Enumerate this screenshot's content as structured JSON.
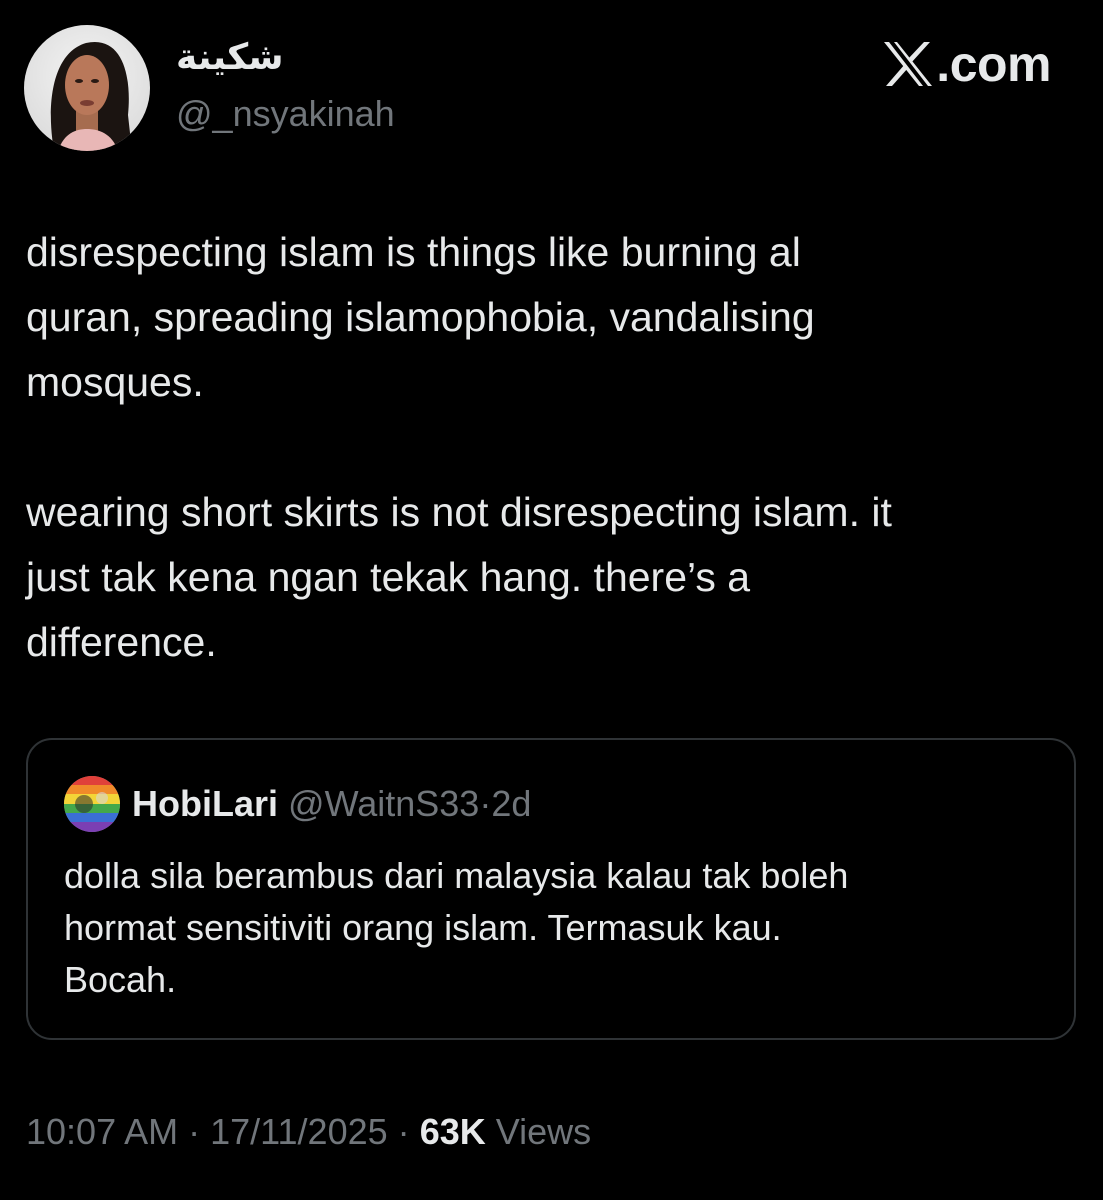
{
  "author": {
    "display_name": "شكينة",
    "handle": "@_nsyakinah"
  },
  "brand": {
    "icon": "x-logo-icon",
    "suffix": ".com"
  },
  "tweet": {
    "paragraphs": [
      "disrespecting islam is things like burning al\nquran, spreading islamophobia, vandalising\nmosques.",
      "wearing short skirts is not disrespecting islam. it\njust tak kena ngan tekak hang. there’s a\ndifference."
    ]
  },
  "quote": {
    "display_name": "HobiLari",
    "handle": "@WaitnS33",
    "separator": "·",
    "time": "2d",
    "text": "dolla sila berambus dari malaysia kalau tak boleh\nhormat sensitiviti orang islam. Termasuk kau.\nBocah."
  },
  "meta": {
    "time": "10:07 AM",
    "separator": "·",
    "date": "17/11/2025",
    "views_count": "63K",
    "views_label": "Views"
  },
  "colors": {
    "background": "#000000",
    "text_primary": "#e7e9ea",
    "text_secondary": "#71767b",
    "border": "#2f3336"
  }
}
